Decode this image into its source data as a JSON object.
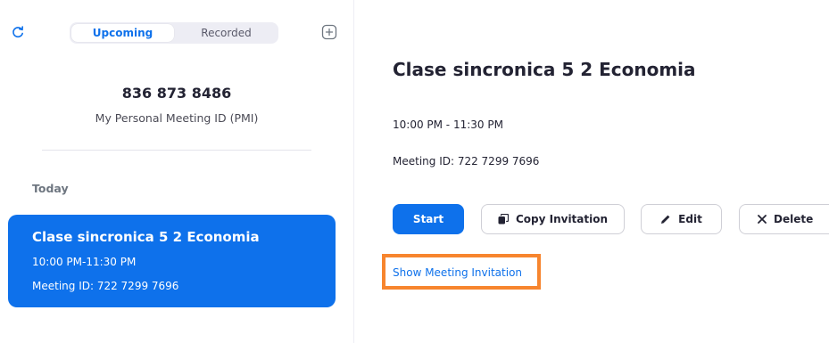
{
  "tabs": {
    "upcoming": "Upcoming",
    "recorded": "Recorded"
  },
  "pmi": {
    "number": "836 873 8486",
    "label": "My Personal Meeting ID (PMI)"
  },
  "list": {
    "section": "Today",
    "meetings": [
      {
        "title": "Clase sincronica 5 2 Economia",
        "time": "10:00 PM-11:30 PM",
        "meeting_id": "Meeting ID: 722 7299 7696",
        "selected": true
      }
    ]
  },
  "detail": {
    "title": "Clase sincronica 5 2 Economia",
    "time": "10:00 PM - 11:30 PM",
    "meeting_id": "Meeting ID: 722 7299 7696",
    "buttons": {
      "start": "Start",
      "copy": "Copy Invitation",
      "edit": "Edit",
      "delete": "Delete"
    },
    "invitation_link": "Show Meeting Invitation"
  },
  "icons": {
    "refresh": "refresh-icon",
    "add": "add-icon",
    "copy": "copy-icon",
    "edit": "pencil-icon",
    "delete": "close-icon"
  },
  "colors": {
    "accent": "#0e71eb",
    "highlight": "#f7852e",
    "text": "#232333",
    "muted": "#6e7680"
  }
}
